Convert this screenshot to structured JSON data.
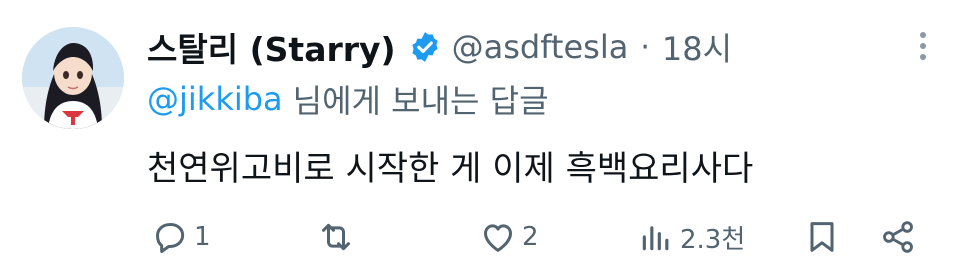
{
  "tweet": {
    "display_name": "스탈리 (Starry)",
    "handle": "@asdftesla",
    "separator": "·",
    "time": "18시",
    "reply_to": {
      "mention": "@jikkiba",
      "suffix": "님에게 보내는 답글"
    },
    "text": "천연위고비로 시작한 게 이제 흑백요리사다"
  },
  "actions": {
    "replies": "1",
    "retweets": "",
    "likes": "2",
    "views": "2.3천"
  },
  "icons": {
    "verified": "verified-badge-icon",
    "more": "more-vertical-icon",
    "reply": "reply-icon",
    "retweet": "retweet-icon",
    "like": "heart-icon",
    "views": "views-chart-icon",
    "bookmark": "bookmark-icon",
    "share": "share-icon"
  },
  "colors": {
    "accent": "#1d9bf0",
    "secondary_text": "#536471",
    "primary_text": "#0f1419"
  }
}
